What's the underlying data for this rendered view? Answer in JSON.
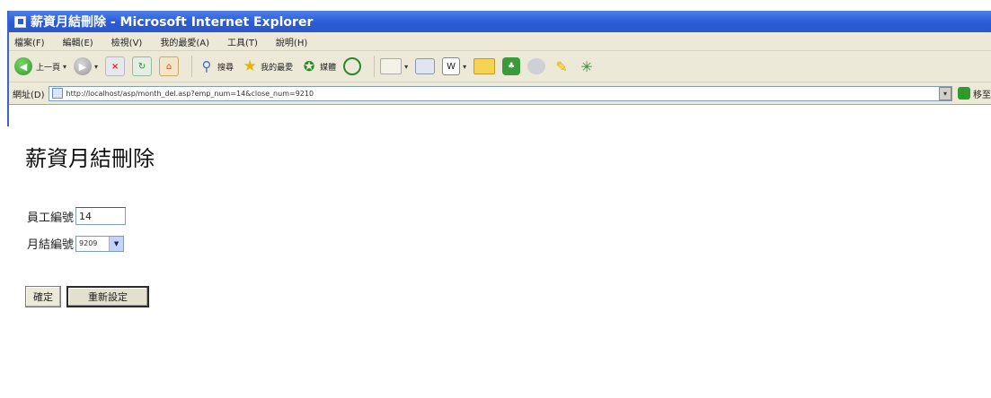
{
  "window": {
    "title": "薪資月結刪除 - Microsoft Internet Explorer"
  },
  "menu": [
    "檔案(F)",
    "編輯(E)",
    "檢視(V)",
    "我的最愛(A)",
    "工具(T)",
    "說明(H)"
  ],
  "toolbar": {
    "back_label": "上一頁",
    "search_label": "搜尋",
    "favorites_label": "我的最愛",
    "media_label": "媒體"
  },
  "address": {
    "label": "網址(D)",
    "url": "http://localhost/asp/month_del.asp?emp_num=14&close_num=9210",
    "go_label": "移至"
  },
  "page": {
    "heading": "薪資月結刪除",
    "emp_label": "員工編號",
    "emp_value": "14",
    "close_label": "月結編號",
    "close_value": "9209",
    "ok_button": "確定",
    "reset_button": "重新設定"
  }
}
